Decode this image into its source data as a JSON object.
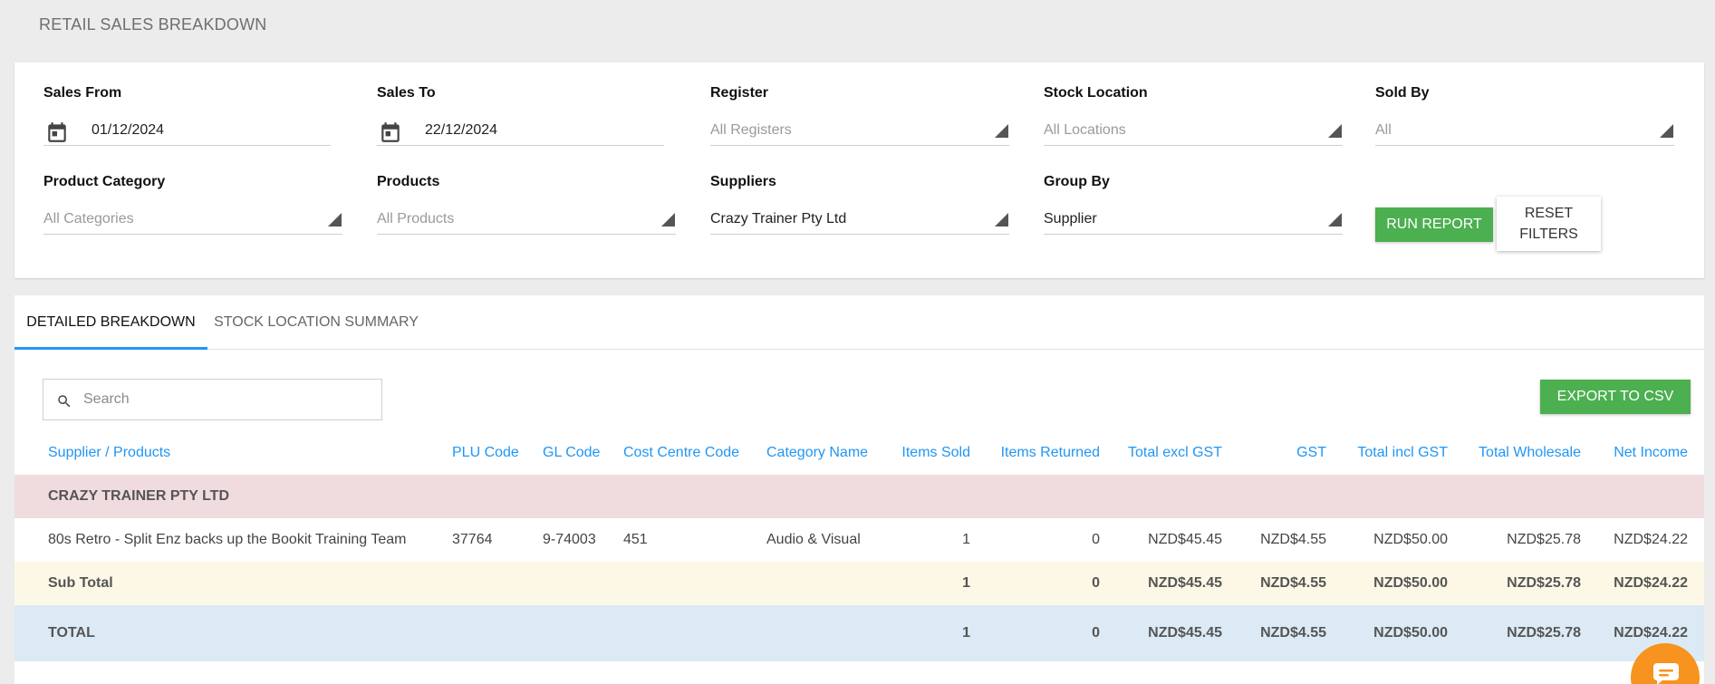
{
  "page": {
    "title": "RETAIL SALES BREAKDOWN"
  },
  "filters": {
    "sales_from": {
      "label": "Sales From",
      "value": "01/12/2024"
    },
    "sales_to": {
      "label": "Sales To",
      "value": "22/12/2024"
    },
    "register": {
      "label": "Register",
      "value": "All Registers"
    },
    "stock_location": {
      "label": "Stock Location",
      "value": "All Locations"
    },
    "sold_by": {
      "label": "Sold By",
      "value": "All"
    },
    "product_category": {
      "label": "Product Category",
      "value": "All Categories"
    },
    "products": {
      "label": "Products",
      "value": "All Products"
    },
    "suppliers": {
      "label": "Suppliers",
      "value": "Crazy Trainer Pty Ltd"
    },
    "group_by": {
      "label": "Group By",
      "value": "Supplier"
    },
    "run_report_label": "RUN REPORT",
    "reset_filters_label": "RESET FILTERS"
  },
  "tabs": [
    {
      "label": "DETAILED BREAKDOWN",
      "active": true
    },
    {
      "label": "STOCK LOCATION SUMMARY",
      "active": false
    }
  ],
  "search": {
    "placeholder": "Search",
    "value": ""
  },
  "export_label": "EXPORT TO CSV",
  "table": {
    "columns": [
      "Supplier / Products",
      "PLU Code",
      "GL Code",
      "Cost Centre Code",
      "Category Name",
      "Items Sold",
      "Items Returned",
      "Total excl GST",
      "GST",
      "Total incl GST",
      "Total Wholesale",
      "Net Income"
    ],
    "group": "CRAZY TRAINER PTY LTD",
    "row": [
      "80s Retro - Split Enz backs up the Bookit Training Team",
      "37764",
      "9-74003",
      "451",
      "Audio & Visual",
      "1",
      "0",
      "NZD$45.45",
      "NZD$4.55",
      "NZD$50.00",
      "NZD$25.78",
      "NZD$24.22"
    ],
    "subtotal": [
      "Sub Total",
      "1",
      "0",
      "NZD$45.45",
      "NZD$4.55",
      "NZD$50.00",
      "NZD$25.78",
      "NZD$24.22"
    ],
    "total": [
      "TOTAL",
      "1",
      "0",
      "NZD$45.45",
      "NZD$4.55",
      "NZD$50.00",
      "NZD$25.78",
      "NZD$24.22"
    ]
  },
  "colors": {
    "accent_green": "#4caf50",
    "link_blue": "#2196f3",
    "chat_orange": "#f7931e"
  },
  "icons": {
    "date": "calendar-icon",
    "dropdown": "dropdown-arrow-icon",
    "search": "search-icon",
    "chat": "chat-icon"
  }
}
